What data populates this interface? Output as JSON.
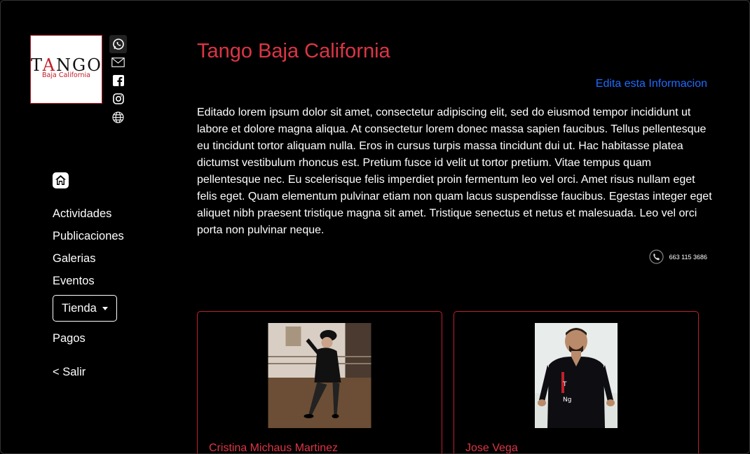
{
  "brand": {
    "logo_main": "TANGO",
    "logo_sub": "Baja California"
  },
  "social_icons": [
    "whatsapp-icon",
    "mail-icon",
    "facebook-icon",
    "instagram-icon",
    "globe-icon"
  ],
  "nav": {
    "home_icon": "home-icon",
    "items": [
      "Actividades",
      "Publicaciones",
      "Galerias",
      "Eventos"
    ],
    "tienda": "Tienda",
    "pagos": "Pagos",
    "salir": "< Salir"
  },
  "main": {
    "title": "Tango Baja California",
    "edit_link": "Edita esta Informacion",
    "description": "Editado lorem ipsum dolor sit amet, consectetur adipiscing elit, sed do eiusmod tempor incididunt ut labore et dolore magna aliqua. At consectetur lorem donec massa sapien faucibus. Tellus pellentesque eu tincidunt tortor aliquam nulla. Eros in cursus turpis massa tincidunt dui ut. Hac habitasse platea dictumst vestibulum rhoncus est. Pretium fusce id velit ut tortor pretium. Vitae tempus quam pellentesque nec. Eu scelerisque felis imperdiet proin fermentum leo vel orci. Amet risus nullam eget felis eget. Quam elementum pulvinar etiam non quam lacus suspendisse faucibus. Egestas integer eget aliquet nibh praesent tristique magna sit amet. Tristique senectus et netus et malesuada. Leo vel orci porta non pulvinar neque.",
    "phone": "663 115 3686"
  },
  "cards": [
    {
      "name": "Cristina Michaus Martinez"
    },
    {
      "name": "Jose Vega"
    }
  ],
  "colors": {
    "accent_red": "#dc3545",
    "link_blue": "#1f6bff",
    "background": "#000000"
  }
}
